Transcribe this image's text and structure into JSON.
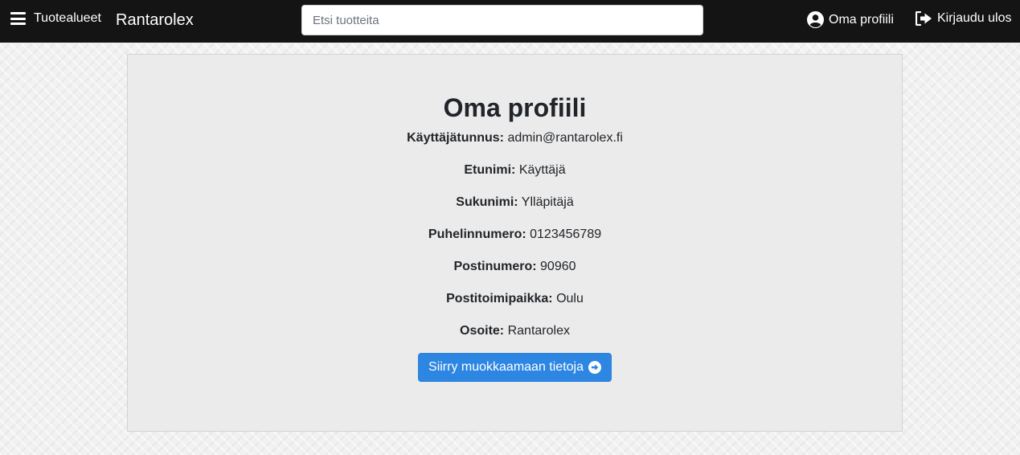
{
  "navbar": {
    "menu_label": "Tuotealueet",
    "brand": "Rantarolex",
    "search_placeholder": "Etsi tuotteita",
    "search_value": "",
    "profile_label": "Oma profiili",
    "logout_label": "Kirjaudu ulos",
    "icons": [
      "bars-icon",
      "user-circle-icon",
      "sign-out-icon"
    ],
    "background_color": "#141414"
  },
  "profile": {
    "title": "Oma profiili",
    "fields": [
      {
        "label": "Käyttäjätunnus:",
        "value": "admin@rantarolex.fi"
      },
      {
        "label": "Etunimi:",
        "value": "Käyttäjä"
      },
      {
        "label": "Sukunimi:",
        "value": "Ylläpitäjä"
      },
      {
        "label": "Puhelinnumero:",
        "value": "0123456789"
      },
      {
        "label": "Postinumero:",
        "value": "90960"
      },
      {
        "label": "Postitoimipaikka:",
        "value": "Oulu"
      },
      {
        "label": "Osoite:",
        "value": "Rantarolex"
      }
    ],
    "edit_button_label": "Siirry muokkaamaan tietoja",
    "edit_button_icon": "arrow-circle-right-icon",
    "edit_button_color": "#2d87e2"
  }
}
